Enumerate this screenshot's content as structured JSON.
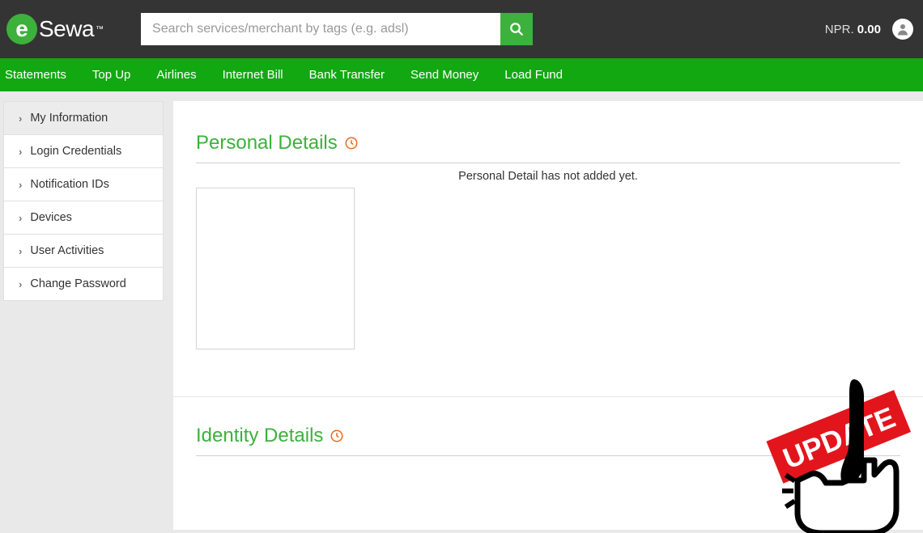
{
  "brand": {
    "e": "e",
    "name": "Sewa",
    "tm": "™"
  },
  "search": {
    "placeholder": "Search services/merchant by tags (e.g. adsl)"
  },
  "balance": {
    "currency": "NPR.",
    "amount": "0.00"
  },
  "nav": {
    "items": [
      "Statements",
      "Top Up",
      "Airlines",
      "Internet Bill",
      "Bank Transfer",
      "Send Money",
      "Load Fund"
    ]
  },
  "sidebar": {
    "items": [
      "My Information",
      "Login Credentials",
      "Notification IDs",
      "Devices",
      "User Activities",
      "Change Password"
    ]
  },
  "sections": {
    "personal": {
      "title": "Personal Details",
      "empty_message": "Personal Detail has not added yet."
    },
    "identity": {
      "title": "Identity Details"
    }
  },
  "overlay": {
    "label": "UPDATE"
  }
}
